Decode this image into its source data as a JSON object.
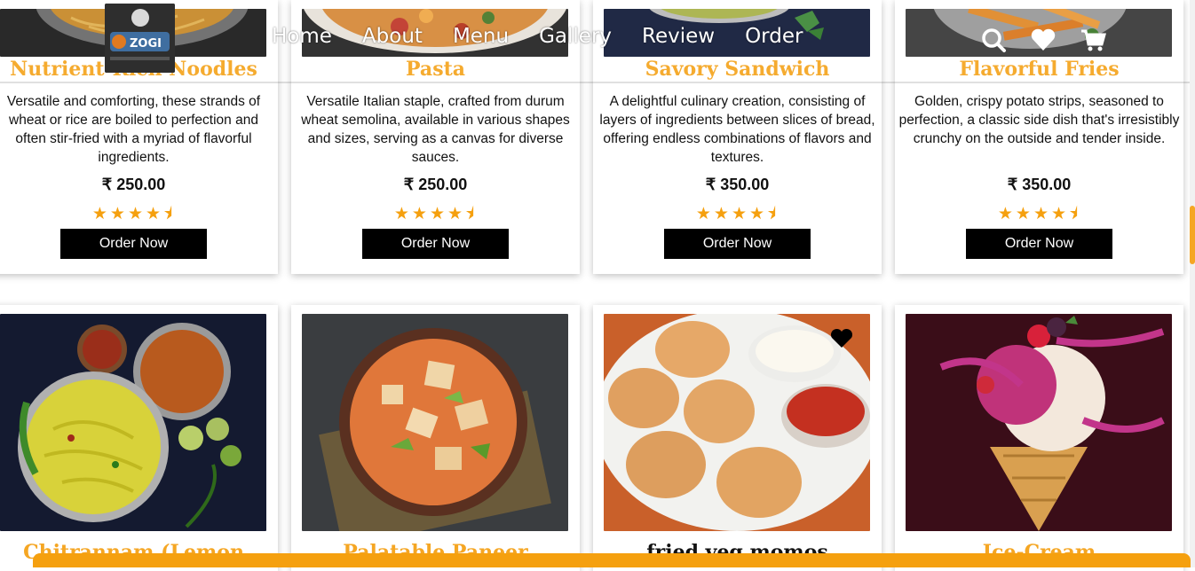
{
  "nav": {
    "logo_text": "ZOGI",
    "links": [
      "Home",
      "About",
      "Menu",
      "Gallery",
      "Review",
      "Order"
    ],
    "icons": [
      "search-icon",
      "heart-icon",
      "cart-icon"
    ]
  },
  "products_row1": [
    {
      "title": "Nutrient-Rich Noodles",
      "desc": "Versatile and comforting, these strands of wheat or rice are boiled to perfection and often stir-fried with a myriad of flavorful ingredients.",
      "price": "₹ 250.00",
      "rating": 4.5,
      "stars": "★★★★⯨",
      "button": "Order Now"
    },
    {
      "title": "Pasta",
      "desc": "Versatile Italian staple, crafted from durum wheat semolina, available in various shapes and sizes, serving as a canvas for diverse sauces.",
      "price": "₹ 250.00",
      "rating": 4.5,
      "stars": "★★★★⯨",
      "button": "Order Now"
    },
    {
      "title": "Savory Sandwich",
      "desc": "A delightful culinary creation, consisting of layers of ingredients between slices of bread, offering endless combinations of flavors and textures.",
      "price": "₹ 350.00",
      "rating": 4.5,
      "stars": "★★★★⯨",
      "button": "Order Now"
    },
    {
      "title": "Flavorful Fries",
      "desc": "Golden, crispy potato strips, seasoned to perfection, a classic side dish that's irresistibly crunchy on the outside and tender inside.",
      "price": "₹ 350.00",
      "rating": 4.5,
      "stars": "★★★★⯨",
      "button": "Order Now"
    }
  ],
  "products_row2": [
    {
      "title": "Chitrannam (Lemon"
    },
    {
      "title": "Palatable Paneer"
    },
    {
      "title": "fried veg momos"
    },
    {
      "title": "Ice-Cream"
    }
  ],
  "colors": {
    "accent": "#f5a623",
    "button_bg": "#000000",
    "star": "#f5a00f"
  }
}
